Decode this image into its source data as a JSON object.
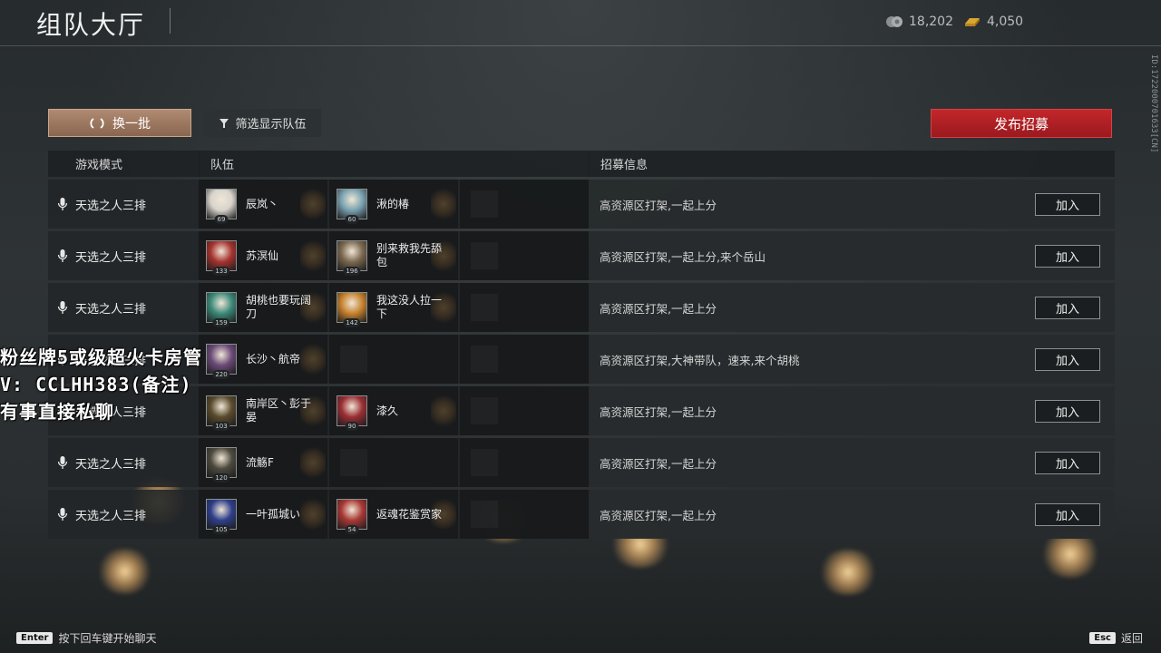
{
  "header": {
    "title": "组队大厅",
    "currency_a": "18,202",
    "currency_b": "4,050",
    "side_id": "ID:1722000701633[CN]"
  },
  "toolbar": {
    "refresh_label": "换一批",
    "filter_label": "筛选显示队伍",
    "publish_label": "发布招募"
  },
  "table": {
    "headers": {
      "mode": "游戏模式",
      "team": "队伍",
      "info": "招募信息"
    },
    "join_label": "加入",
    "rows": [
      {
        "mode": "天选之人三排",
        "info": "高资源区打架,一起上分",
        "players": [
          {
            "name": "辰岚丶",
            "level": "69",
            "color": "#d8d4cc"
          },
          {
            "name": "湫的椿",
            "level": "60",
            "color": "#7aa3b2"
          }
        ]
      },
      {
        "mode": "天选之人三排",
        "info": "高资源区打架,一起上分,来个岳山",
        "players": [
          {
            "name": "苏溟仙",
            "level": "133",
            "color": "#a6332f"
          },
          {
            "name": "别来救我先舔包",
            "level": "196",
            "color": "#7a6850"
          }
        ]
      },
      {
        "mode": "天选之人三排",
        "info": "高资源区打架,一起上分",
        "players": [
          {
            "name": "胡桃也要玩阔刀",
            "level": "159",
            "color": "#3c8a7a"
          },
          {
            "name": "我这没人拉一下",
            "level": "142",
            "color": "#c6822e"
          }
        ]
      },
      {
        "mode": "天选之人三排",
        "info": "高资源区打架,大神带队，速来,来个胡桃",
        "players": [
          {
            "name": "长沙丶航帝",
            "level": "220",
            "color": "#6b4a78"
          }
        ]
      },
      {
        "mode": "天选之人三排",
        "info": "高资源区打架,一起上分",
        "players": [
          {
            "name": "南岸区丶彭于晏",
            "level": "103",
            "color": "#5a4b2e"
          },
          {
            "name": "漆久",
            "level": "90",
            "color": "#9a2f34"
          }
        ]
      },
      {
        "mode": "天选之人三排",
        "info": "高资源区打架,一起上分",
        "players": [
          {
            "name": "流觞F",
            "level": "120",
            "color": "#4d4a3e"
          }
        ]
      },
      {
        "mode": "天选之人三排",
        "info": "高资源区打架,一起上分",
        "players": [
          {
            "name": "一叶孤城い",
            "level": "105",
            "color": "#2e3f8a"
          },
          {
            "name": "返魂花鉴赏家",
            "level": "54",
            "color": "#a83834"
          }
        ]
      }
    ]
  },
  "overlay": {
    "line1": "粉丝牌5或级超火卡房管",
    "line2": "V: CCLHH383(备注)",
    "line3": "有事直接私聊"
  },
  "footer": {
    "enter_key": "Enter",
    "enter_hint": "按下回车键开始聊天",
    "esc_key": "Esc",
    "esc_hint": "返回"
  },
  "colors": {
    "accent_red": "#c2262a",
    "refresh_brown": "#9c7660"
  }
}
